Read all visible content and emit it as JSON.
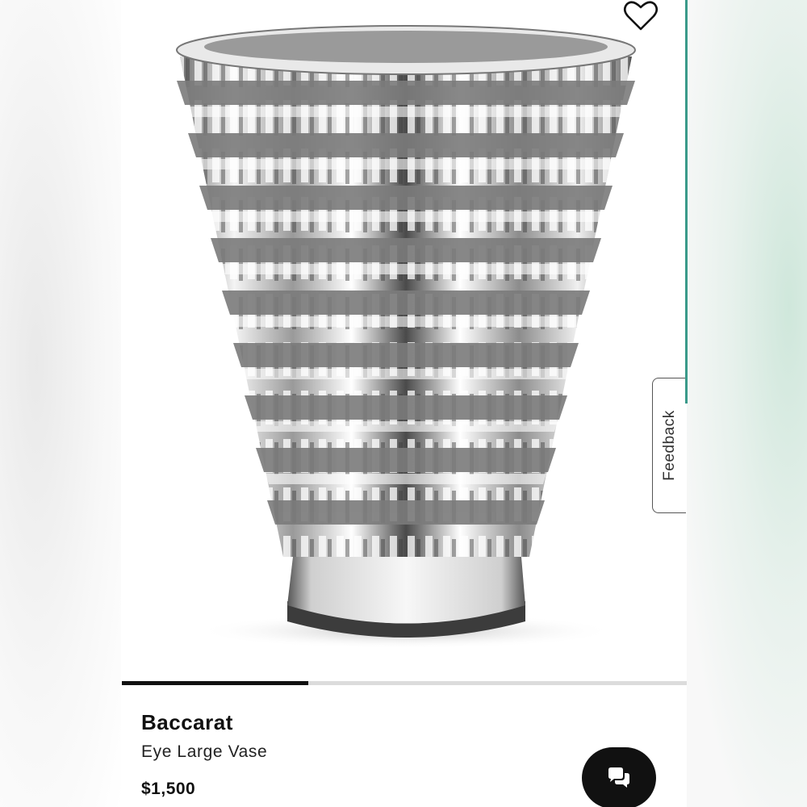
{
  "product": {
    "brand": "Baccarat",
    "name": "Eye Large Vase",
    "price": "$1,500"
  },
  "feedback": {
    "label": "Feedback"
  },
  "gallery": {
    "progress": 0.33
  },
  "icons": {
    "favorite": "heart-outline-icon",
    "chat": "chat-bubbles-icon"
  },
  "colors": {
    "accent": "#111111",
    "track": "#dcdcdc",
    "edge": "#3a9a8a"
  }
}
